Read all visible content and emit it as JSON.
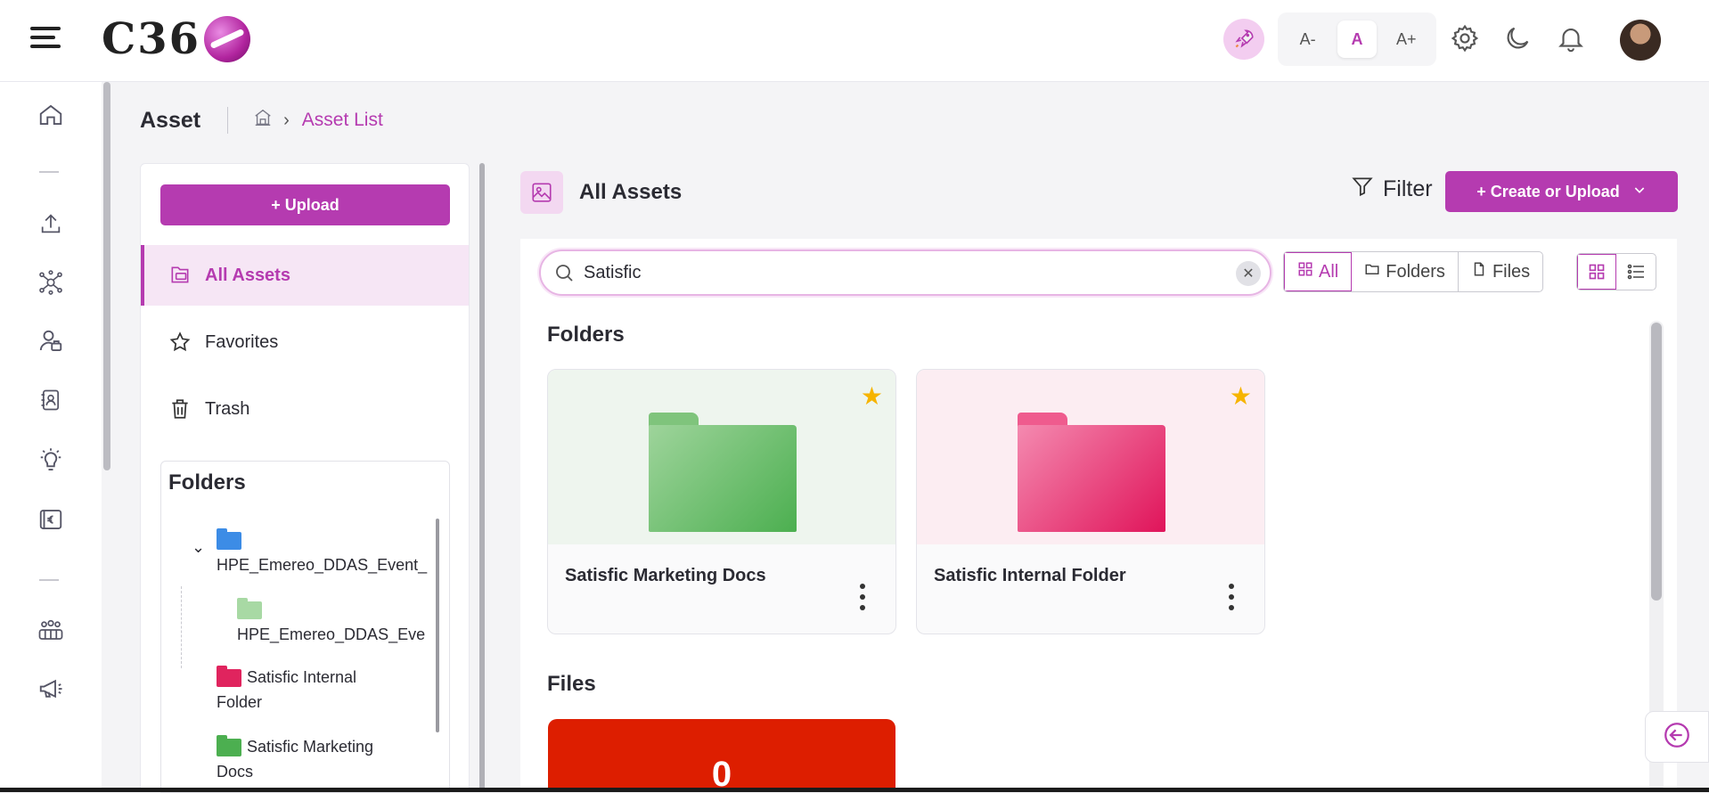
{
  "topbar": {
    "logo_text": "C36",
    "font_small": "A-",
    "font_normal": "A",
    "font_large": "A+"
  },
  "page": {
    "title": "Asset",
    "breadcrumb_current": "Asset List"
  },
  "left_panel": {
    "upload_label": "+ Upload",
    "nav": [
      {
        "label": "All Assets",
        "icon": "all-assets-icon"
      },
      {
        "label": "Favorites",
        "icon": "star-outline-icon"
      },
      {
        "label": "Trash",
        "icon": "trash-icon"
      }
    ],
    "folders_title": "Folders",
    "tree": [
      {
        "label": "HPE_Emereo_DDAS_Event_",
        "color": "#3c8ce6"
      },
      {
        "label": "HPE_Emereo_DDAS_Eve",
        "color": "#a8d9a4"
      },
      {
        "label_line1": "Satisfic Internal",
        "label_line2": "Folder",
        "color": "#e0245e"
      },
      {
        "label_line1": "Satisfic Marketing",
        "label_line2": "Docs",
        "color": "#4caf50"
      }
    ]
  },
  "main": {
    "title": "All Assets",
    "filter_label": "Filter",
    "create_label": "+ Create or Upload",
    "search_value": "Satisfic",
    "seg": {
      "all": "All",
      "folders": "Folders",
      "files": "Files"
    },
    "folders_heading": "Folders",
    "files_heading": "Files",
    "folders": [
      {
        "name": "Satisfic Marketing Docs",
        "color": "#4caf50",
        "favorite": true
      },
      {
        "name": "Satisfic Internal Folder",
        "color": "#e0245e",
        "favorite": true
      }
    ],
    "file_preview_char": "0"
  },
  "colors": {
    "accent": "#b53bb0",
    "accent_light": "#f6e6f5",
    "star": "#f6b400",
    "file_red": "#dd1e00"
  }
}
